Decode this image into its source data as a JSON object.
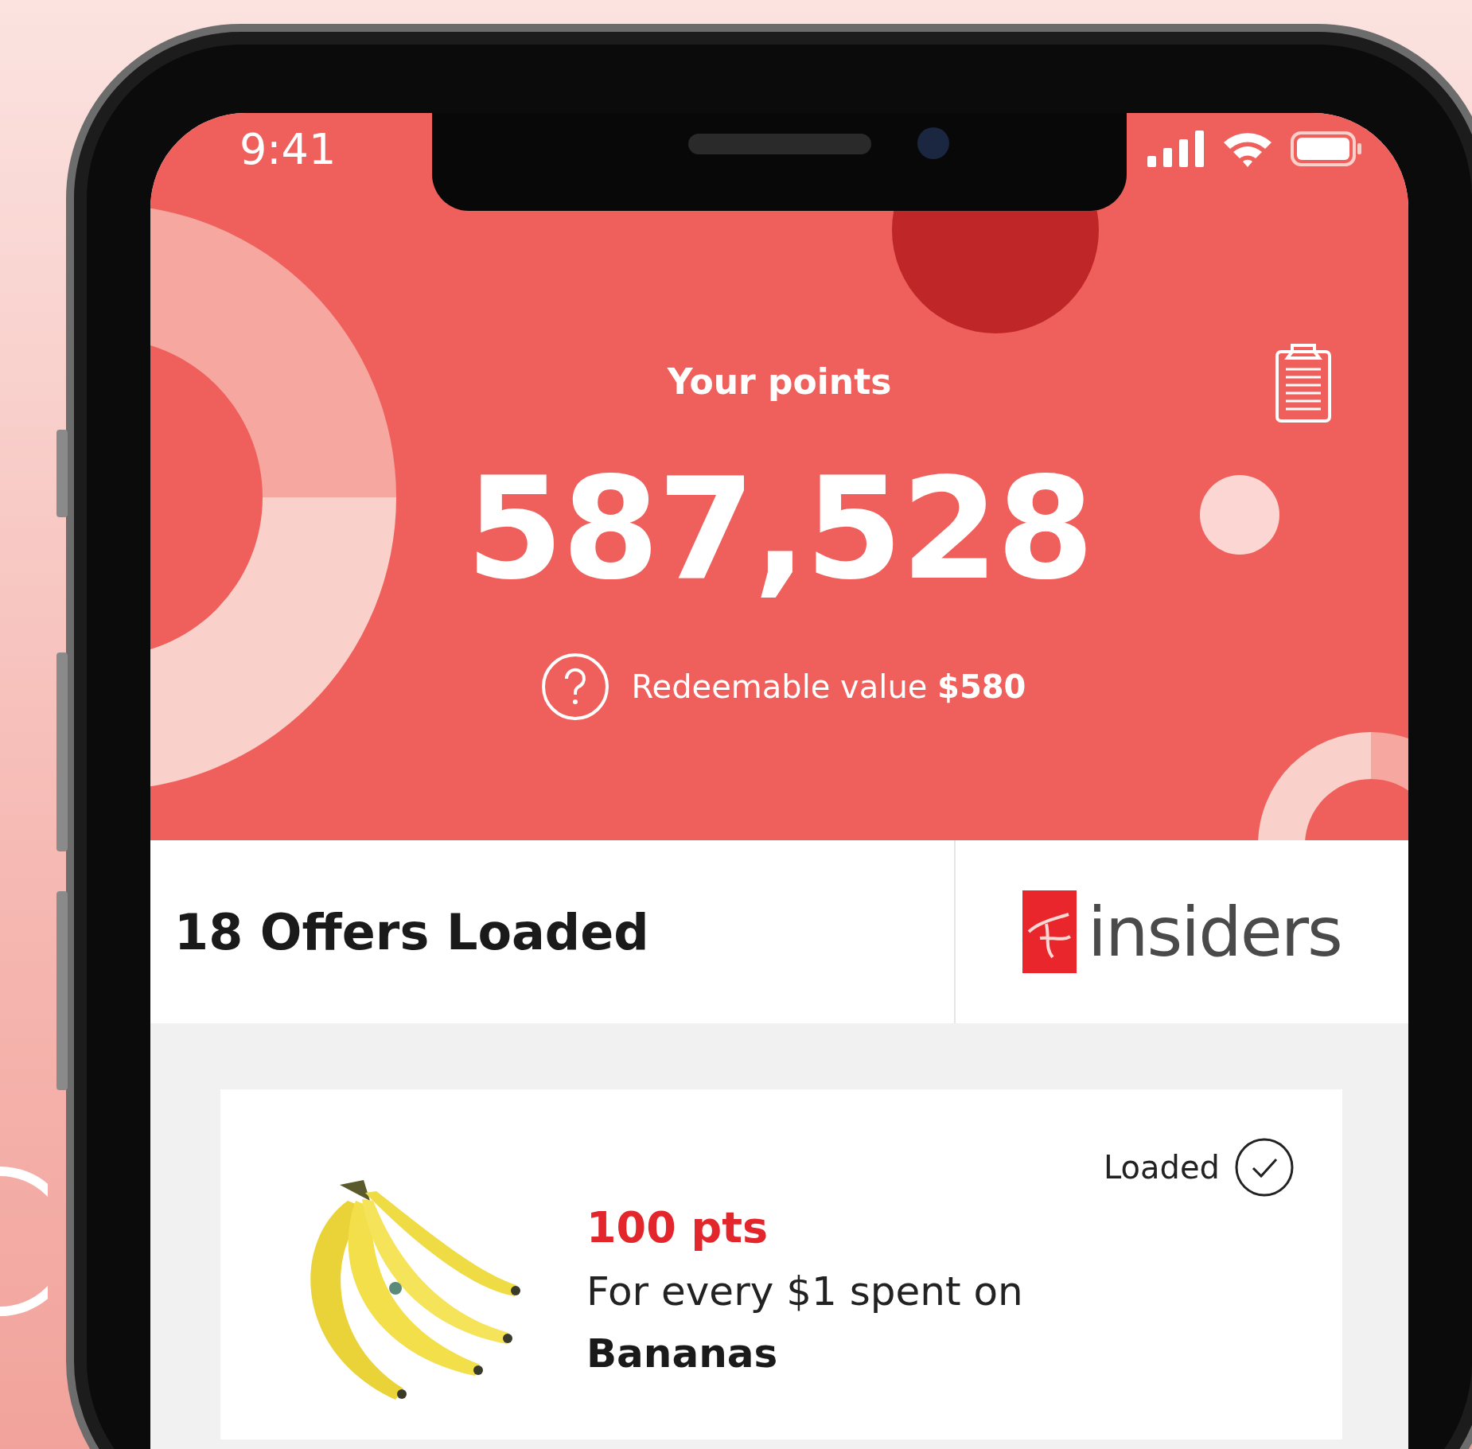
{
  "status_bar": {
    "time": "9:41"
  },
  "points": {
    "label": "Your points",
    "value": "587,528",
    "redeemable": "Redeemable value **$580**"
  },
  "offers_bar": {
    "title": "18 Offers Loaded",
    "logo_text": "insiders"
  },
  "offers": [
    {
      "status": "Loaded",
      "loaded": true,
      "points": "100 pts",
      "description": "For every $1 spent on",
      "product": "Bananas"
    }
  ]
}
